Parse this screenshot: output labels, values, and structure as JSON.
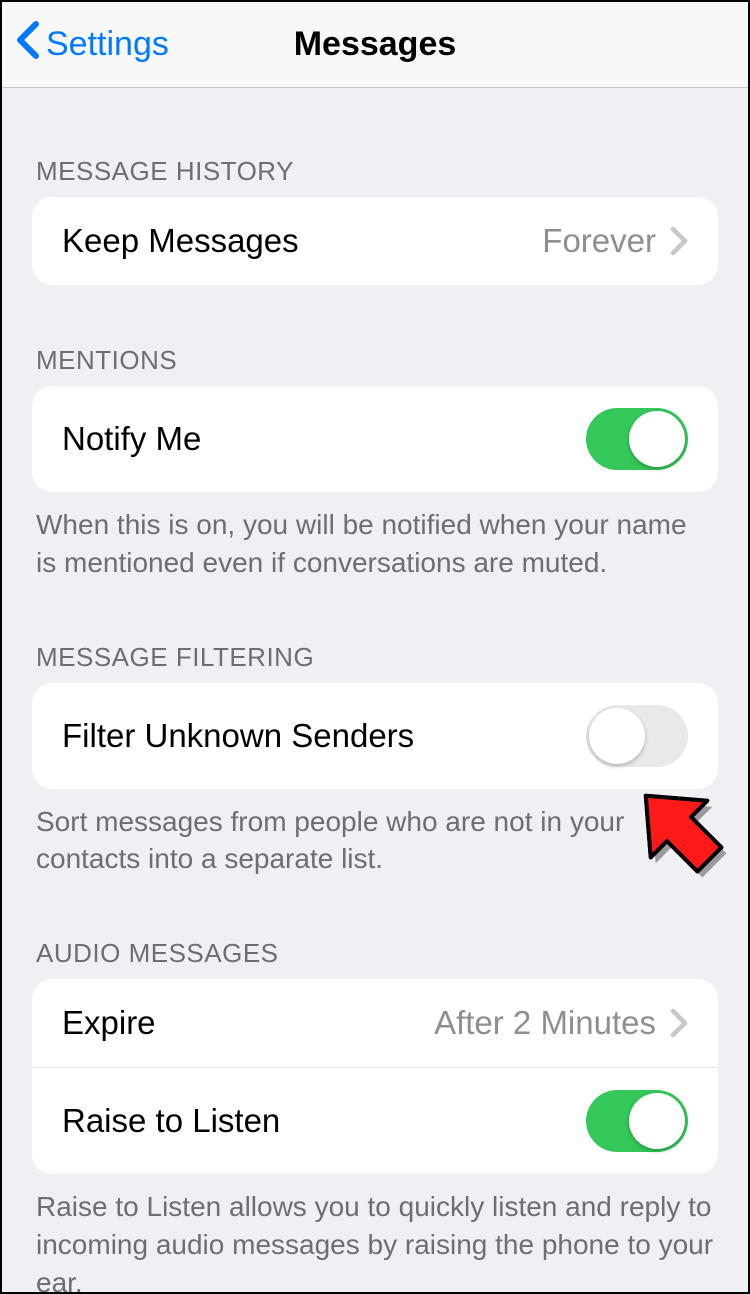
{
  "nav": {
    "back_label": "Settings",
    "title": "Messages"
  },
  "sections": {
    "history": {
      "header": "MESSAGE HISTORY",
      "keep_label": "Keep Messages",
      "keep_value": "Forever"
    },
    "mentions": {
      "header": "MENTIONS",
      "notify_label": "Notify Me",
      "notify_on": true,
      "footer": "When this is on, you will be notified when your name is mentioned even if conversations are muted."
    },
    "filtering": {
      "header": "MESSAGE FILTERING",
      "filter_label": "Filter Unknown Senders",
      "filter_on": false,
      "footer": "Sort messages from people who are not in your contacts into a separate list."
    },
    "audio": {
      "header": "AUDIO MESSAGES",
      "expire_label": "Expire",
      "expire_value": "After 2 Minutes",
      "raise_label": "Raise to Listen",
      "raise_on": true,
      "footer": "Raise to Listen allows you to quickly listen and reply to incoming audio messages by raising the phone to your ear."
    }
  }
}
